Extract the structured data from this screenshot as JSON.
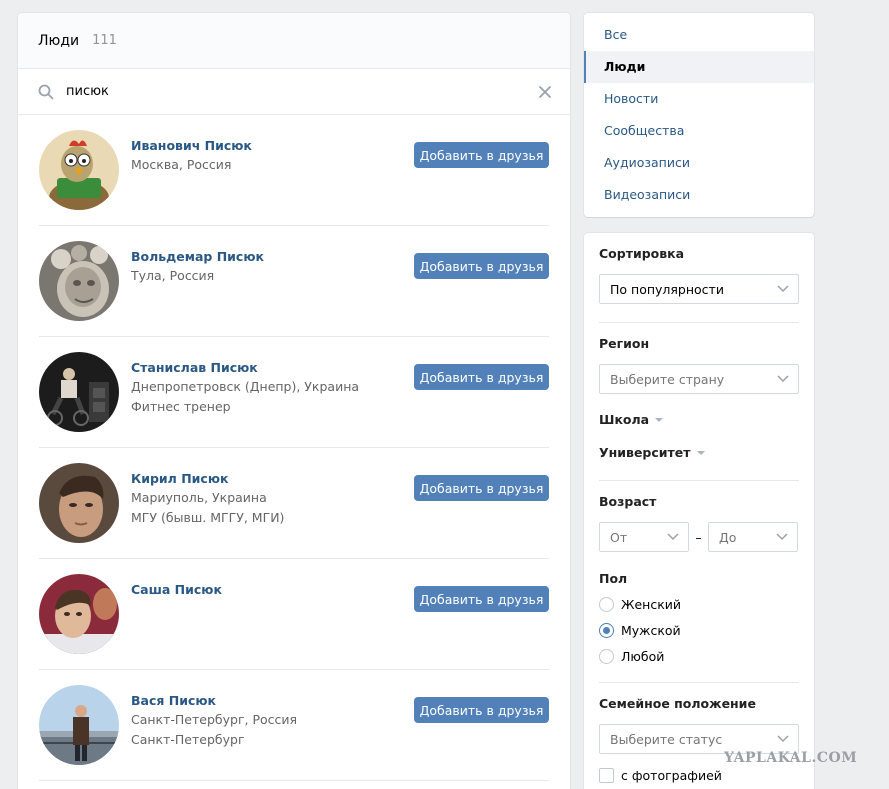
{
  "header": {
    "title": "Люди",
    "count": "111"
  },
  "search": {
    "query": "писюк",
    "icon": "search-icon",
    "clear_icon": "close-icon"
  },
  "people": [
    {
      "name": "Иванович Писюк",
      "lines": [
        "Москва, Россия"
      ],
      "button": "Добавить в друзья"
    },
    {
      "name": "Вольдемар Писюк",
      "lines": [
        "Тула, Россия"
      ],
      "button": "Добавить в друзья"
    },
    {
      "name": "Станислав Писюк",
      "lines": [
        "Днепропетровск (Днепр), Украина",
        "Фитнес тренер"
      ],
      "button": "Добавить в друзья"
    },
    {
      "name": "Кирил Писюк",
      "lines": [
        "Мариуполь, Украина",
        "МГУ (бывш. МГГУ, МГИ)"
      ],
      "button": "Добавить в друзья"
    },
    {
      "name": "Саша Писюк",
      "lines": [],
      "button": "Добавить в друзья"
    },
    {
      "name": "Вася Писюк",
      "lines": [
        "Санкт-Петербург, Россия",
        "Санкт-Петербург"
      ],
      "button": "Добавить в друзья"
    }
  ],
  "menu": {
    "items": [
      {
        "label": "Все",
        "active": false
      },
      {
        "label": "Люди",
        "active": true
      },
      {
        "label": "Новости",
        "active": false
      },
      {
        "label": "Сообщества",
        "active": false
      },
      {
        "label": "Аудиозаписи",
        "active": false
      },
      {
        "label": "Видеозаписи",
        "active": false
      }
    ]
  },
  "filters": {
    "sort": {
      "label": "Сортировка",
      "value": "По популярности"
    },
    "region": {
      "label": "Регион",
      "placeholder": "Выберите страну"
    },
    "school": {
      "label": "Школа"
    },
    "university": {
      "label": "Университет"
    },
    "age": {
      "label": "Возраст",
      "from": "От",
      "to": "До",
      "dash": "–"
    },
    "gender": {
      "label": "Пол",
      "options": [
        {
          "label": "Женский",
          "checked": false
        },
        {
          "label": "Мужской",
          "checked": true
        },
        {
          "label": "Любой",
          "checked": false
        }
      ]
    },
    "marital": {
      "label": "Семейное положение",
      "placeholder": "Выберите статус"
    },
    "with_photo": {
      "label": "с фотографией",
      "checked": false
    }
  },
  "watermark": "YAPLAKAL.COM",
  "colors": {
    "accent": "#5181b8",
    "link": "#2a5885",
    "background": "#edeef0"
  }
}
